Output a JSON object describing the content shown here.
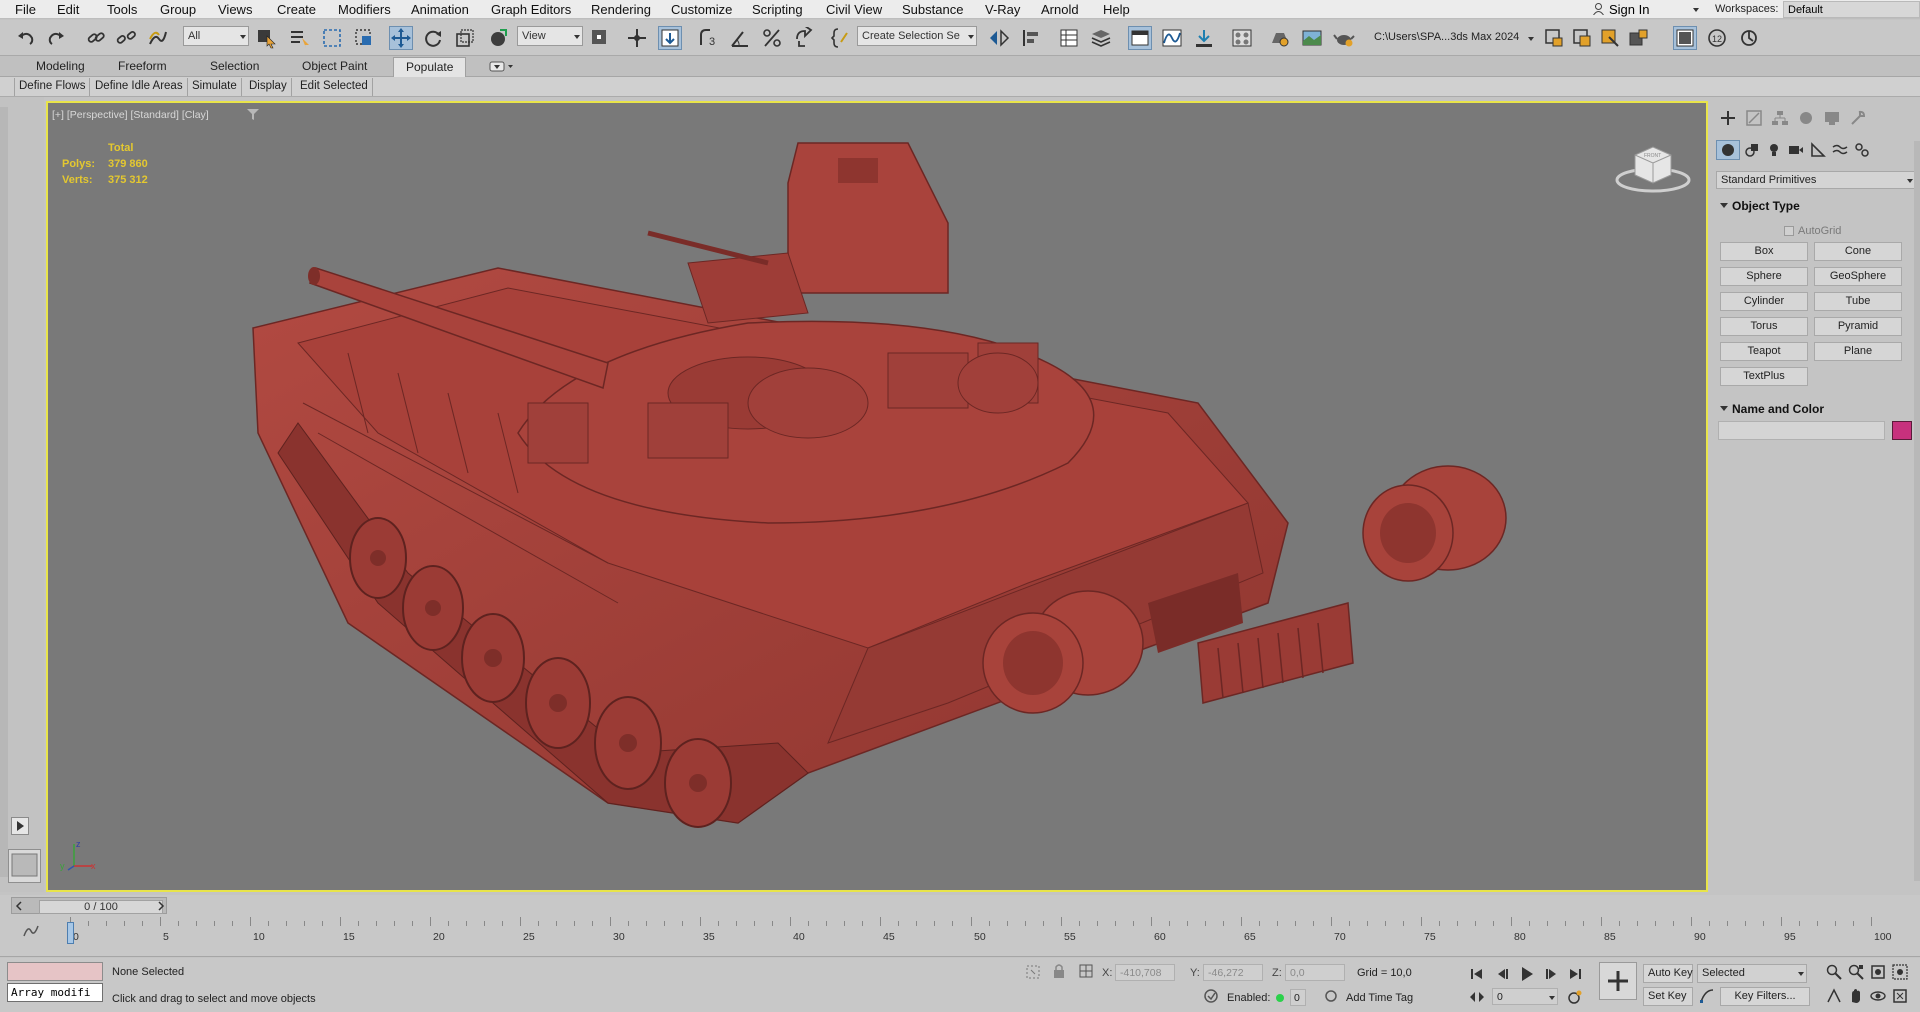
{
  "menu": [
    "File",
    "Edit",
    "Tools",
    "Group",
    "Views",
    "Create",
    "Modifiers",
    "Animation",
    "Graph Editors",
    "Rendering",
    "Customize",
    "Scripting",
    "Civil View",
    "Substance",
    "V-Ray",
    "Arnold",
    "Help"
  ],
  "account": {
    "sign_in": "Sign In"
  },
  "workspaces": {
    "label": "Workspaces:",
    "value": "Default"
  },
  "toolbar": {
    "filter": "All",
    "ref_coord": "View",
    "selection_set": "Create Selection Se",
    "project_path": "C:\\Users\\SPA...3ds Max 2024"
  },
  "ribbon": {
    "tabs": [
      "Modeling",
      "Freeform",
      "Selection",
      "Object Paint",
      "Populate"
    ],
    "active_tab": "Populate",
    "populate_buttons": [
      "Define Flows",
      "Define Idle Areas",
      "Simulate",
      "Display",
      "Edit Selected"
    ]
  },
  "viewport": {
    "label": "[+] [Perspective] [Standard] [Clay]",
    "stats": {
      "title": "Total",
      "polys_label": "Polys:",
      "polys": "379 860",
      "verts_label": "Verts:",
      "verts": "375 312"
    },
    "axis": {
      "x": "x",
      "y": "y",
      "z": "z"
    },
    "viewcube_face": "FRONT"
  },
  "command_panel": {
    "category": "Standard Primitives",
    "object_type_title": "Object Type",
    "autogrid": "AutoGrid",
    "buttons": [
      "Box",
      "Cone",
      "Sphere",
      "GeoSphere",
      "Cylinder",
      "Tube",
      "Torus",
      "Pyramid",
      "Teapot",
      "Plane",
      "TextPlus"
    ],
    "name_color_title": "Name and Color",
    "object_color": "#c7317d"
  },
  "timeline": {
    "slider": "0 / 100",
    "ticks": [
      "0",
      "5",
      "10",
      "15",
      "20",
      "25",
      "30",
      "35",
      "40",
      "45",
      "50",
      "55",
      "60",
      "65",
      "70",
      "75",
      "80",
      "85",
      "90",
      "95",
      "100"
    ]
  },
  "status": {
    "maxscript_text": "Array modifi",
    "selection": "None Selected",
    "prompt": "Click and drag to select and move objects",
    "x_label": "X:",
    "x": "-410,708",
    "y_label": "Y:",
    "y": "-46,272",
    "z_label": "Z:",
    "z": "0,0",
    "grid": "Grid = 10,0",
    "enabled_label": "Enabled:",
    "enabled_value": "0",
    "add_time_tag": "Add Time Tag",
    "auto_key": "Auto Key",
    "set_key": "Set Key",
    "key_mode": "Selected",
    "frame": "0",
    "key_filters": "Key Filters..."
  },
  "colors": {
    "viewport_bg": "#797979",
    "viewport_border": "#e8e44a",
    "tank": "#a8413a",
    "stats_text": "#e4c830"
  }
}
